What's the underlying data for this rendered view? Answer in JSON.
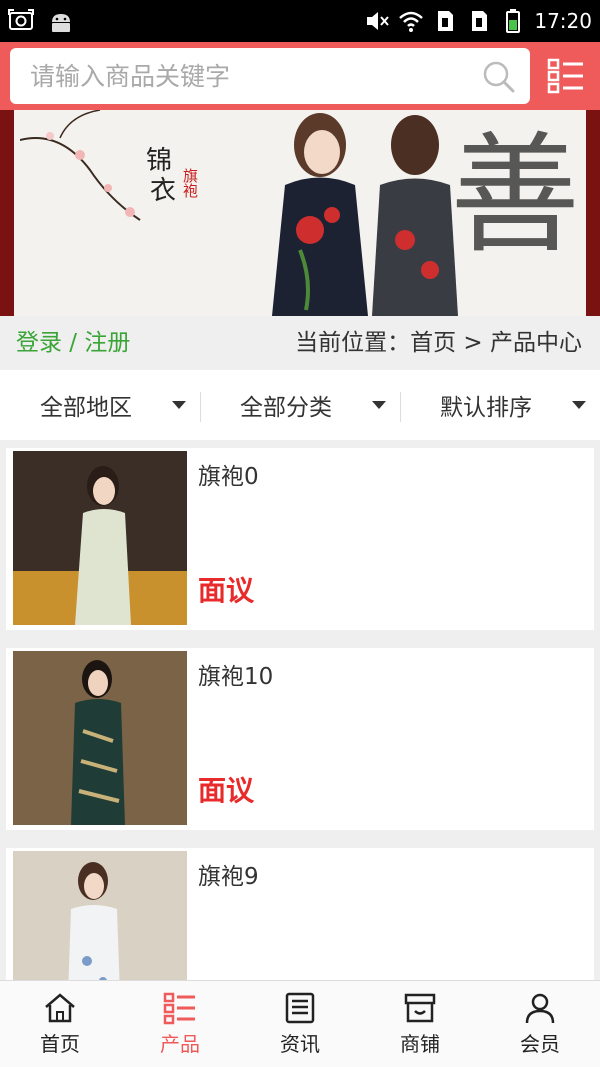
{
  "status_bar": {
    "time": "17:20"
  },
  "search": {
    "placeholder": "请输入商品关键字"
  },
  "banner": {
    "title_line1": "锦",
    "title_line2": "衣",
    "red_text": "旗袍",
    "big_char": "善"
  },
  "location_bar": {
    "login": "登录 / 注册",
    "breadcrumb": "当前位置：首页 > 产品中心"
  },
  "filters": [
    {
      "label": "全部地区"
    },
    {
      "label": "全部分类"
    },
    {
      "label": "默认排序"
    }
  ],
  "products": [
    {
      "name": "旗袍0",
      "price": "面议"
    },
    {
      "name": "旗袍10",
      "price": "面议"
    },
    {
      "name": "旗袍9",
      "price": ""
    }
  ],
  "bottom_nav": [
    {
      "label": "首页",
      "icon": "home-icon"
    },
    {
      "label": "产品",
      "icon": "product-list-icon",
      "active": true
    },
    {
      "label": "资讯",
      "icon": "news-icon"
    },
    {
      "label": "商铺",
      "icon": "shop-icon"
    },
    {
      "label": "会员",
      "icon": "member-icon"
    }
  ],
  "colors": {
    "accent": "#ef5b5b",
    "login_green": "#3aa536",
    "price_red": "#e82a2a"
  }
}
